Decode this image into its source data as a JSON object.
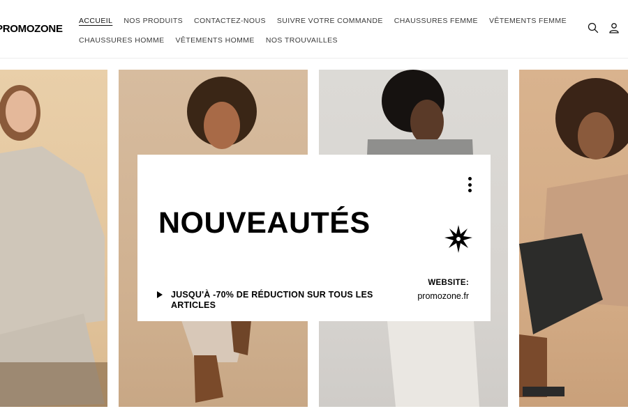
{
  "brand": {
    "logo_text": "ROMOZONE"
  },
  "nav": {
    "row1": [
      "ACCUEIL",
      "NOS PRODUITS",
      "CONTACTEZ-NOUS",
      "SUIVRE VOTRE COMMANDE",
      "CHAUSSURES FEMME",
      "VÊTEMENTS FEMME"
    ],
    "row2": [
      "CHAUSSURES HOMME",
      "VÊTEMENTS HOMME",
      "NOS TROUVAILLES"
    ],
    "active": "ACCUEIL"
  },
  "header_icons": [
    "search-icon",
    "account-icon"
  ],
  "banner": {
    "headline": "NOUVEAUTÉS",
    "promo": "JUSQU'À -70% DE RÉDUCTION SUR TOUS LES ARTICLES",
    "website_label": "WEBSITE:",
    "website_url": "promozone.fr"
  },
  "colors": {
    "accent": "#121212",
    "background": "#ffffff"
  }
}
